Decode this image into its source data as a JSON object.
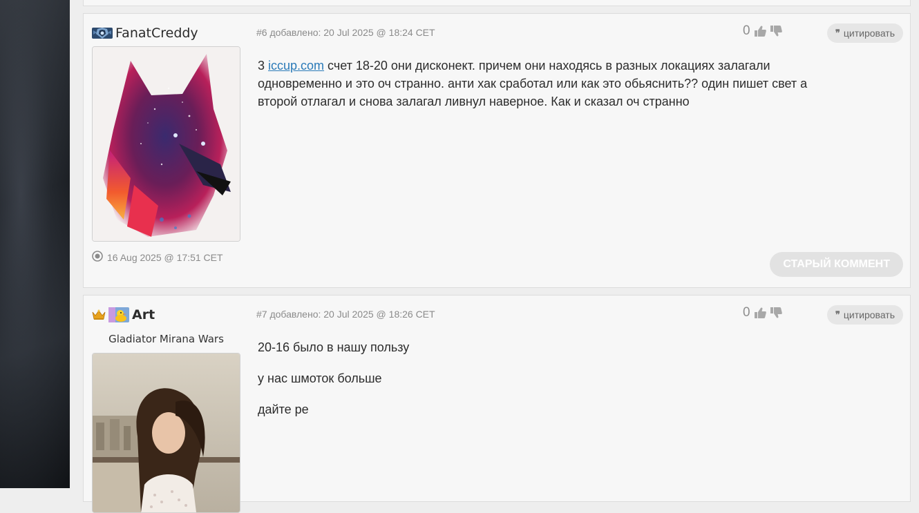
{
  "posts": [
    {
      "username": "FanatCreddy",
      "post_meta": "#6 добавлено: 20 Jul 2025 @ 18:24 CET",
      "vote_count": "0",
      "quote_label": "цитировать",
      "body_prefix": "3 ",
      "body_link": "iccup.com",
      "body_suffix": " счет 18-20 они дисконект. причем они находясь в разных локациях залагали одновременно и это оч странно. анти хак сработал или как это обьяснить?? один пишет свет а второй отлагал и снова залагал ливнул наверное. Как и сказал оч странно",
      "last_seen": "16 Aug 2025 @ 17:51 CET",
      "old_comment_label": "СТАРЫЙ КОММЕНТ",
      "avatar_icon": "wolf-avatar"
    },
    {
      "username": "Art",
      "user_subtitle": "Gladiator Mirana Wars",
      "post_meta": "#7 добавлено: 20 Jul 2025 @ 18:26 CET",
      "vote_count": "0",
      "quote_label": "цитировать",
      "paragraphs": [
        "20-16 было в нашу пользу",
        "у нас шмоток больше",
        "дайте ре"
      ],
      "avatar_icon": "portrait-avatar"
    }
  ],
  "colors": {
    "link": "#2a7ab8",
    "card_bg": "#f7f7f7",
    "page_bg": "#eeeeee",
    "button_bg": "#e6e6e6"
  }
}
